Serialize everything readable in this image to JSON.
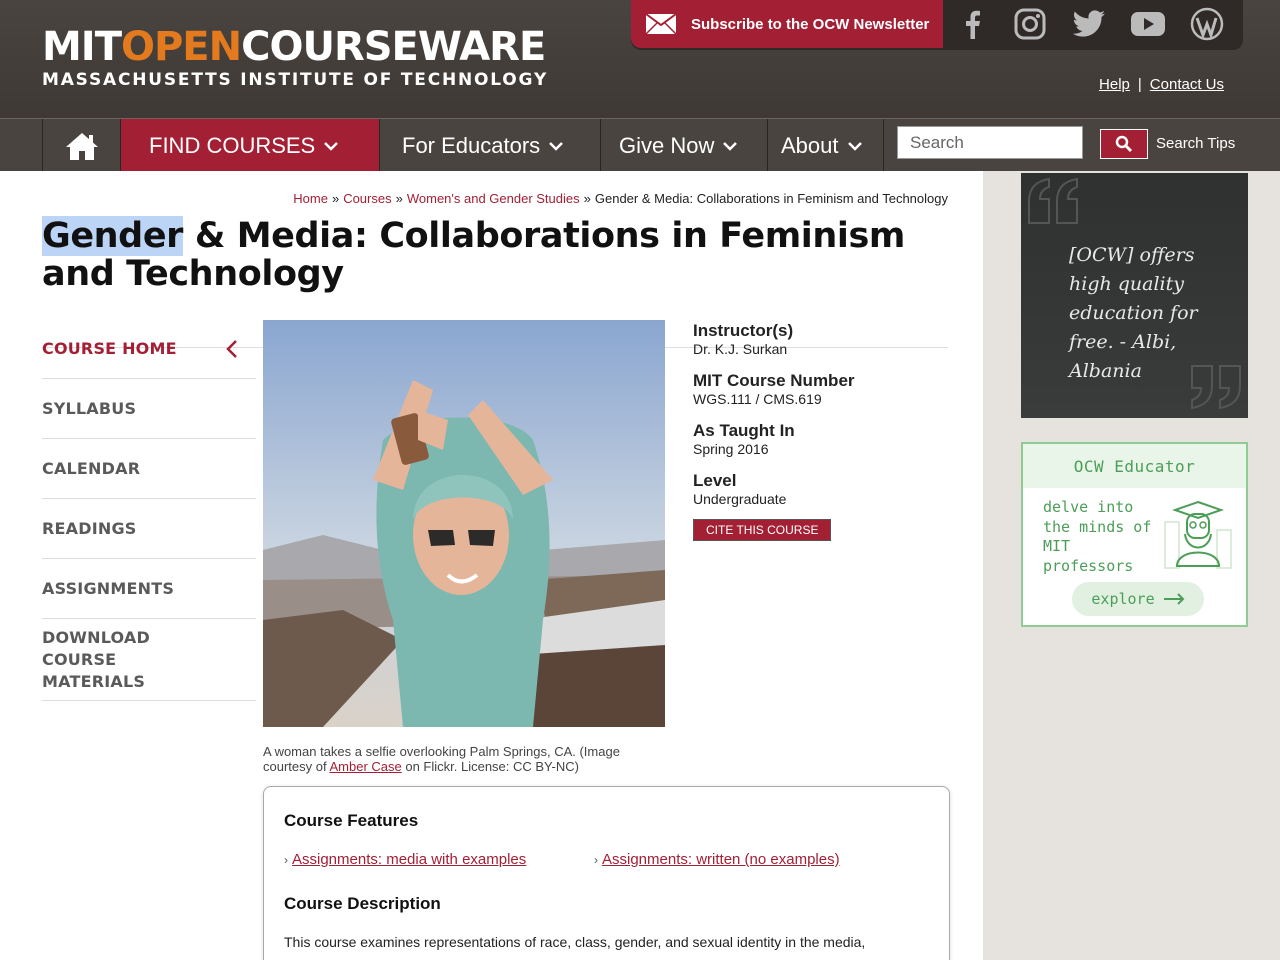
{
  "header": {
    "logo": {
      "mit": "MIT",
      "open": "OPEN",
      "courseware": "COURSEWARE",
      "subtitle": "MASSACHUSETTS INSTITUTE OF TECHNOLOGY"
    },
    "newsletter": "Subscribe to the OCW Newsletter",
    "social": [
      "facebook-icon",
      "instagram-icon",
      "twitter-icon",
      "youtube-icon",
      "wordpress-icon"
    ],
    "help": "Help",
    "contact": "Contact Us"
  },
  "nav": {
    "find_courses": "FIND COURSES",
    "for_educators": "For Educators",
    "give_now": "Give Now",
    "about": "About",
    "search_placeholder": "Search",
    "search_tips": "Search Tips"
  },
  "breadcrumb": {
    "home": "Home",
    "courses": "Courses",
    "dept": "Women's and Gender Studies",
    "current": "Gender & Media: Collaborations in Feminism and Technology",
    "sep": "»"
  },
  "title": {
    "highlight": "Gender",
    "rest": " & Media: Collaborations in Feminism and Technology"
  },
  "sidenav": [
    "COURSE HOME",
    "SYLLABUS",
    "CALENDAR",
    "READINGS",
    "ASSIGNMENTS",
    "DOWNLOAD COURSE MATERIALS"
  ],
  "caption": {
    "pre": "A woman takes a selfie overlooking Palm Springs, CA. (Image courtesy of ",
    "link": "Amber Case",
    "post": " on Flickr. License: CC BY-NC)"
  },
  "info": {
    "instructor_h": "Instructor(s)",
    "instructor_v": "Dr. K.J. Surkan",
    "number_h": "MIT Course Number",
    "number_v": "WGS.111 / CMS.619",
    "taught_h": "As Taught In",
    "taught_v": "Spring 2016",
    "level_h": "Level",
    "level_v": "Undergraduate",
    "cite": "CITE THIS COURSE"
  },
  "features": {
    "heading": "Course Features",
    "links": [
      "Assignments: media with examples",
      "Assignments: written (no examples)"
    ],
    "desc_heading": "Course Description",
    "desc": "This course examines representations of race, class, gender, and sexual identity in the media,"
  },
  "quote": {
    "text": "[OCW] offers high quality education for free. - Albi, Albania"
  },
  "educator": {
    "heading": "OCW Educator",
    "text": "delve into the minds of MIT professors",
    "button": "explore"
  },
  "colors": {
    "brand_red": "#a31f34",
    "header_bg": "#4a4440",
    "open_orange": "#e47a1e",
    "educator_green": "#4c9e57"
  }
}
